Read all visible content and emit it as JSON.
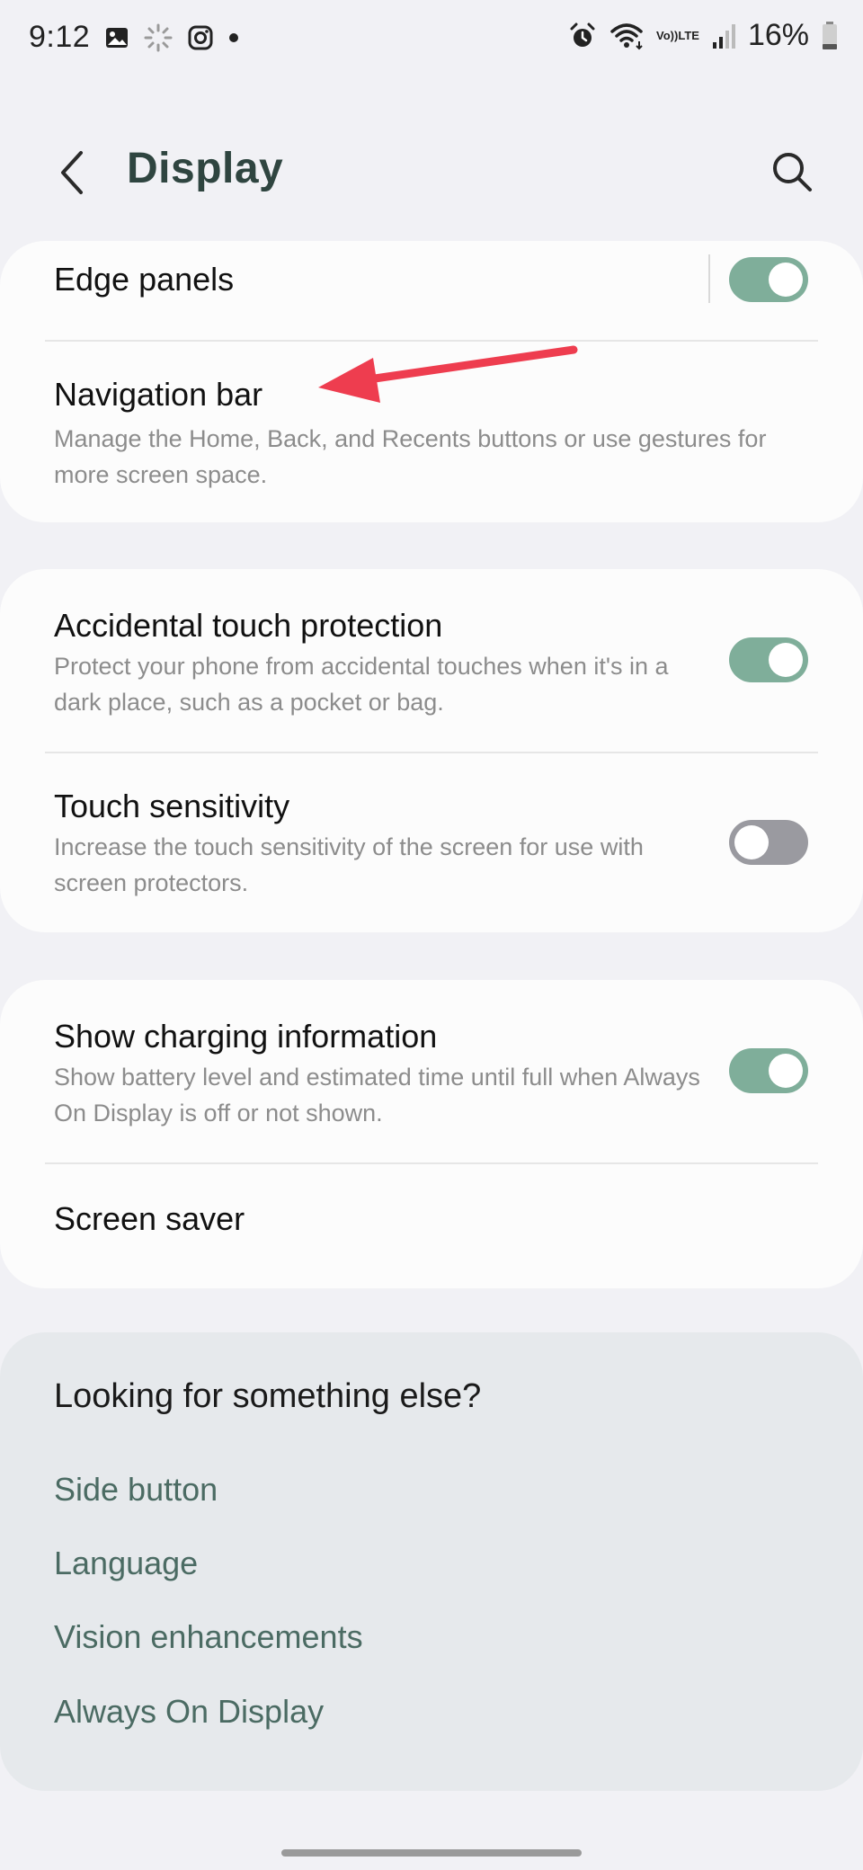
{
  "status_bar": {
    "time": "9:12",
    "battery_percent": "16%",
    "volte_line1": "Vo))",
    "volte_line2": "LTE",
    "icons_left": [
      "gallery-icon",
      "loading-icon",
      "instagram-icon",
      "dot-icon"
    ],
    "icons_right": [
      "alarm-icon",
      "wifi-icon",
      "volte-icon",
      "signal-icon",
      "battery-icon"
    ]
  },
  "header": {
    "title": "Display",
    "back_icon": "chevron-left-icon",
    "search_icon": "search-icon"
  },
  "group1": {
    "edge_panels": {
      "title": "Edge panels",
      "toggle_on": true
    },
    "navigation_bar": {
      "title": "Navigation bar",
      "subtitle": "Manage the Home, Back, and Recents buttons or use gestures for more screen space."
    }
  },
  "group2": {
    "accidental_touch": {
      "title": "Accidental touch protection",
      "subtitle": "Protect your phone from accidental touches when it's in a dark place, such as a pocket or bag.",
      "toggle_on": true
    },
    "touch_sensitivity": {
      "title": "Touch sensitivity",
      "subtitle": "Increase the touch sensitivity of the screen for use with screen protectors.",
      "toggle_on": false
    }
  },
  "group3": {
    "charging_info": {
      "title": "Show charging information",
      "subtitle": "Show battery level and estimated time until full when Always On Display is off or not shown.",
      "toggle_on": true
    },
    "screen_saver": {
      "title": "Screen saver"
    }
  },
  "looking": {
    "title": "Looking for something else?",
    "links": [
      "Side button",
      "Language",
      "Vision enhancements",
      "Always On Display"
    ]
  },
  "colors": {
    "toggle_on": "#7fae9a",
    "toggle_off": "#9a9aa0",
    "title_color": "#2f4540",
    "link_color": "#4b6b63",
    "annotation_arrow": "#ee3d4f"
  }
}
